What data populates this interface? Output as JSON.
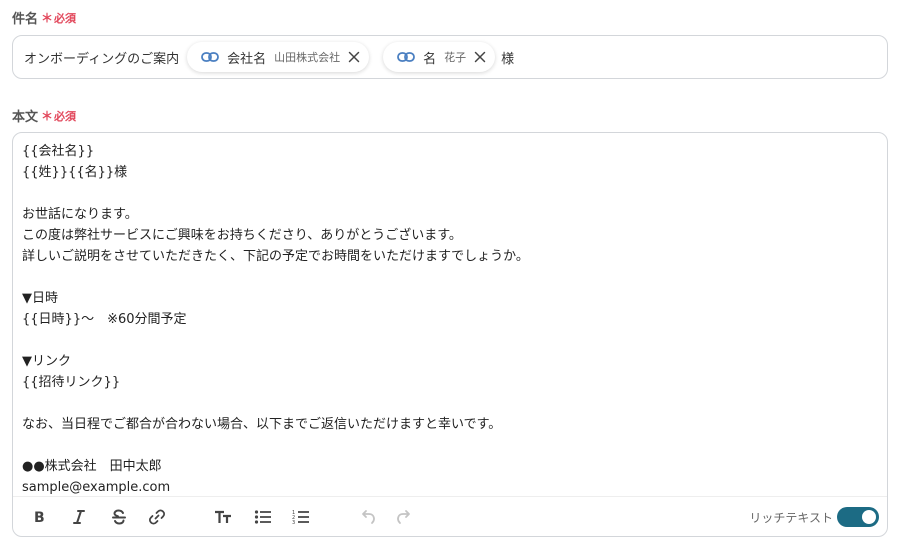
{
  "subject": {
    "label": "件名",
    "required_mark": "＊",
    "required_text": "必須",
    "prefix_text": "オンボーディングのご案内",
    "chips": [
      {
        "name": "会社名",
        "value": "山田株式会社"
      },
      {
        "name": "名",
        "value": "花子"
      }
    ],
    "suffix_text": "様"
  },
  "body": {
    "label": "本文",
    "required_mark": "＊",
    "required_text": "必須",
    "lines": [
      "{{会社名}}",
      "{{姓}}{{名}}様",
      "",
      "お世話になります。",
      "この度は弊社サービスにご興味をお持ちくださり、ありがとうございます。",
      "詳しいご説明をさせていただきたく、下記の予定でお時間をいただけますでしょうか。",
      "",
      "▼日時",
      "{{日時}}〜　※60分間予定",
      "",
      "▼リンク",
      "{{招待リンク}}",
      "",
      "なお、当日程でご都合が合わない場合、以下までご返信いただけますと幸いです。",
      "",
      "●●株式会社　田中太郎",
      "sample@example.com"
    ]
  },
  "toolbar": {
    "icons": [
      "bold-icon",
      "italic-icon",
      "strikethrough-icon",
      "link-icon",
      "text-size-icon",
      "bullet-list-icon",
      "numbered-list-icon",
      "undo-icon",
      "redo-icon"
    ],
    "rich_text_label": "リッチテキスト",
    "rich_text_enabled": true
  },
  "colors": {
    "required": "#e2475b",
    "chip_link_icon": "#4a7fc1",
    "toggle_on": "#1c6b84"
  }
}
